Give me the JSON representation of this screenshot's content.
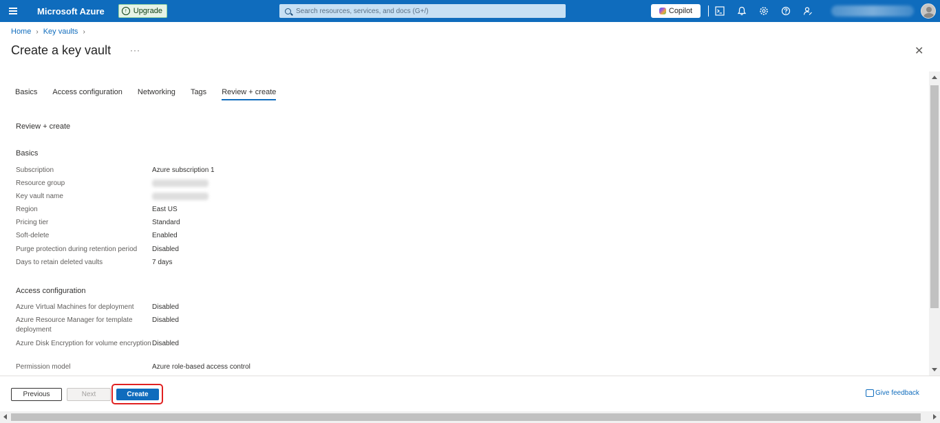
{
  "topbar": {
    "brand": "Microsoft Azure",
    "upgrade_label": "Upgrade",
    "search_placeholder": "Search resources, services, and docs (G+/)",
    "copilot_label": "Copilot",
    "icons": [
      "menu-icon",
      "upgrade-icon",
      "search-icon",
      "copilot-icon",
      "cloud-shell-icon",
      "notifications-icon",
      "settings-icon",
      "help-icon",
      "feedback-icon",
      "avatar"
    ]
  },
  "breadcrumb": {
    "items": [
      "Home",
      "Key vaults"
    ]
  },
  "page": {
    "title": "Create a key vault",
    "more": "···",
    "close": "✕"
  },
  "tabs": [
    "Basics",
    "Access configuration",
    "Networking",
    "Tags",
    "Review + create"
  ],
  "active_tab": "Review + create",
  "review_heading": "Review + create",
  "basics": {
    "title": "Basics",
    "rows": [
      {
        "label": "Subscription",
        "value": "Azure subscription 1"
      },
      {
        "label": "Resource group",
        "value": ""
      },
      {
        "label": "Key vault name",
        "value": ""
      },
      {
        "label": "Region",
        "value": "East US"
      },
      {
        "label": "Pricing tier",
        "value": "Standard"
      },
      {
        "label": "Soft-delete",
        "value": "Enabled"
      },
      {
        "label": "Purge protection during retention period",
        "value": "Disabled"
      },
      {
        "label": "Days to retain deleted vaults",
        "value": "7 days"
      }
    ]
  },
  "access": {
    "title": "Access configuration",
    "rows": [
      {
        "label": "Azure Virtual Machines for deployment",
        "value": "Disabled"
      },
      {
        "label": "Azure Resource Manager for template deployment",
        "value": "Disabled"
      },
      {
        "label": "Azure Disk Encryption for volume encryption",
        "value": "Disabled"
      },
      {
        "label": "Permission model",
        "value": "Azure role-based access control"
      }
    ]
  },
  "footer": {
    "previous": "Previous",
    "next": "Next",
    "create": "Create",
    "feedback": "Give feedback"
  },
  "colors": {
    "brand": "#0f6cbd",
    "highlight": "#e02020"
  }
}
